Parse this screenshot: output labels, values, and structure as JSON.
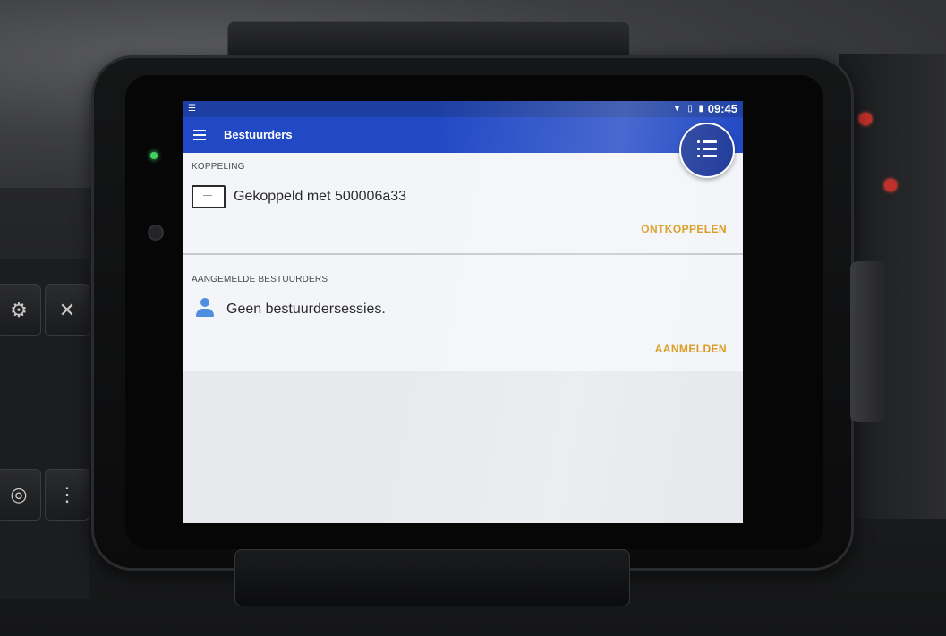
{
  "status_bar": {
    "left_icon": "notification-icon",
    "icons": [
      "wifi-icon",
      "no-sim-icon",
      "battery-icon"
    ],
    "time": "09:45"
  },
  "app_bar": {
    "menu_icon": "hamburger-menu-icon",
    "title": "Bestuurders",
    "fab_icon": "list-icon"
  },
  "coupling": {
    "header": "KOPPELING",
    "icon": "device-icon",
    "text": "Gekoppeld met 500006a33",
    "action": "ONTKOPPELEN"
  },
  "drivers": {
    "header": "AANGEMELDE BESTUURDERS",
    "icon": "person-icon",
    "text": "Geen bestuurdersessies.",
    "action": "AANMELDEN"
  },
  "colors": {
    "status_bar": "#1d3fa4",
    "app_bar": "#2148c5",
    "fab": "#203b9b",
    "action_text": "#d99a1c",
    "person_icon": "#4f8fe0"
  }
}
